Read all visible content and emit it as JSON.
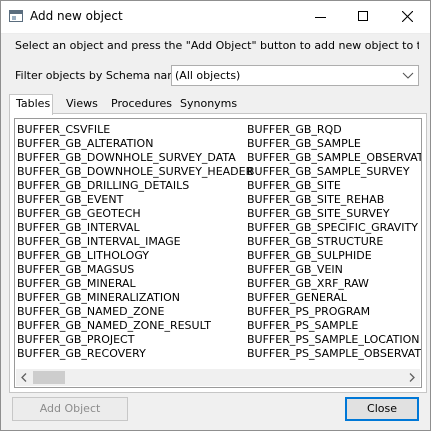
{
  "window": {
    "title": "Add new object",
    "instruction": "Select an object and press the \"Add Object\" button to add new object to the q"
  },
  "filter": {
    "label": "Filter objects by Schema name",
    "selected": "(All objects)"
  },
  "tabs": [
    {
      "label": "Tables",
      "active": true
    },
    {
      "label": "Views",
      "active": false
    },
    {
      "label": "Procedures",
      "active": false
    },
    {
      "label": "Synonyms",
      "active": false
    }
  ],
  "objects": {
    "column1": [
      "BUFFER_CSVFILE",
      "BUFFER_GB_ALTERATION",
      "BUFFER_GB_DOWNHOLE_SURVEY_DATA",
      "BUFFER_GB_DOWNHOLE_SURVEY_HEADER",
      "BUFFER_GB_DRILLING_DETAILS",
      "BUFFER_GB_EVENT",
      "BUFFER_GB_GEOTECH",
      "BUFFER_GB_INTERVAL",
      "BUFFER_GB_INTERVAL_IMAGE",
      "BUFFER_GB_LITHOLOGY",
      "BUFFER_GB_MAGSUS",
      "BUFFER_GB_MINERAL",
      "BUFFER_GB_MINERALIZATION",
      "BUFFER_GB_NAMED_ZONE",
      "BUFFER_GB_NAMED_ZONE_RESULT",
      "BUFFER_GB_PROJECT",
      "BUFFER_GB_RECOVERY"
    ],
    "column2": [
      "BUFFER_GB_RQD",
      "BUFFER_GB_SAMPLE",
      "BUFFER_GB_SAMPLE_OBSERVATION",
      "BUFFER_GB_SAMPLE_SURVEY",
      "BUFFER_GB_SITE",
      "BUFFER_GB_SITE_REHAB",
      "BUFFER_GB_SITE_SURVEY",
      "BUFFER_GB_SPECIFIC_GRAVITY",
      "BUFFER_GB_STRUCTURE",
      "BUFFER_GB_SULPHIDE",
      "BUFFER_GB_VEIN",
      "BUFFER_GB_XRF_RAW",
      "BUFFER_GENERAL",
      "BUFFER_PS_PROGRAM",
      "BUFFER_PS_SAMPLE",
      "BUFFER_PS_SAMPLE_LOCATION",
      "BUFFER_PS_SAMPLE_OBSERVATION"
    ]
  },
  "buttons": {
    "add_object": "Add Object",
    "close": "Close"
  },
  "icons": {
    "app": "window-icon",
    "minimize": "minimize-icon",
    "maximize": "maximize-icon",
    "close": "close-icon",
    "dropdown": "chevron-down-icon",
    "scroll_left": "arrow-left-icon",
    "scroll_right": "arrow-right-icon"
  },
  "colors": {
    "focus_border": "#0078d7",
    "disabled_text": "#8c8c8c"
  }
}
